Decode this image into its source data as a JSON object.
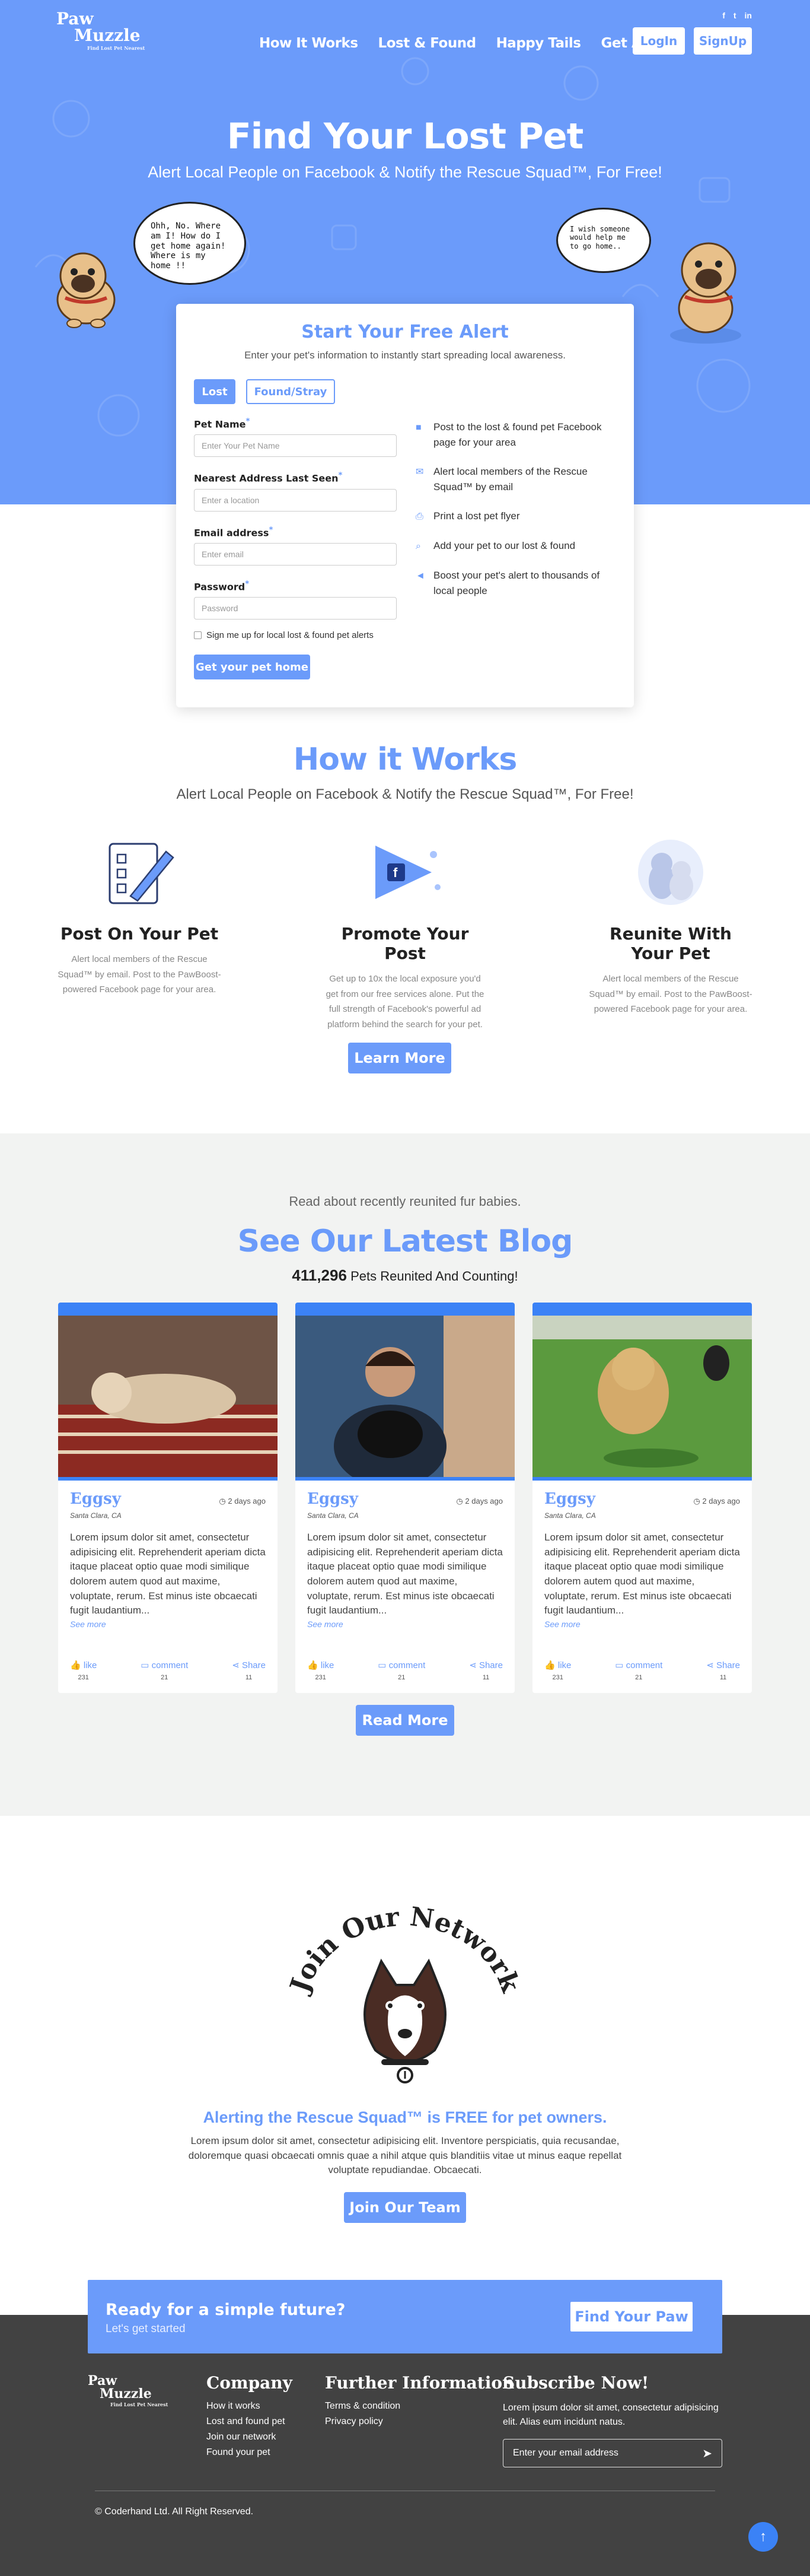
{
  "brand": {
    "line1": "Paw",
    "line2": "Muzzle",
    "tagline": "Find Lost Pet Nearest",
    "accent": "#6b9bfa"
  },
  "social": [
    "f",
    "t",
    "in"
  ],
  "nav": {
    "items": [
      "How It Works",
      "Lost & Found",
      "Happy Tails",
      "Get Alert"
    ],
    "login": "LogIn",
    "signup": "SignUp"
  },
  "hero": {
    "title": "Find Your Lost Pet",
    "subtitle": "Alert Local People on Facebook & Notify the Rescue Squad™, For Free!",
    "bubble1": "Ohh, No. Where am I! How do I get home again! Where is my home !!",
    "bubble2": "I wish someone would help me to go home.."
  },
  "form": {
    "title": "Start Your Free Alert",
    "subtitle": "Enter your pet's information to instantly start spreading local awareness.",
    "tab_lost": "Lost",
    "tab_found": "Found/Stray",
    "fields": [
      {
        "label": "Pet Name",
        "placeholder": "Enter Your Pet Name"
      },
      {
        "label": "Nearest Address Last Seen",
        "placeholder": "Enter a location"
      },
      {
        "label": "Email address",
        "placeholder": "Enter email"
      },
      {
        "label": "Password",
        "placeholder": "Password"
      }
    ],
    "required_mark": "*",
    "checkbox": "Sign me up for local lost & found pet alerts",
    "submit": "Get your pet home",
    "features": [
      {
        "icon": "facebook-icon",
        "text": "Post to the lost & found pet Facebook page for your area"
      },
      {
        "icon": "envelope-icon",
        "text": "Alert local members of the Rescue Squad™ by email"
      },
      {
        "icon": "printer-icon",
        "text": "Print a lost pet flyer"
      },
      {
        "icon": "search-icon",
        "text": "Add your pet to our lost & found"
      },
      {
        "icon": "megaphone-icon",
        "text": "Boost your pet's alert to thousands of local people"
      }
    ]
  },
  "how": {
    "title": "How it Works",
    "subtitle": "Alert Local People on Facebook & Notify the Rescue Squad™, For Free!",
    "steps": [
      {
        "title": "Post On Your Pet",
        "desc": "Alert local members of the Rescue Squad™ by email. Post to the PawBoost-powered Facebook page for your area."
      },
      {
        "title": "Promote Your Post",
        "desc": "Get up to 10x the local exposure you'd get from our free services alone. Put the full strength of Facebook's powerful ad platform behind the search for your pet."
      },
      {
        "title": "Reunite With Your Pet",
        "desc": "Alert local members of the Rescue Squad™ by email. Post to the PawBoost-powered Facebook page for your area."
      }
    ],
    "button": "Learn More"
  },
  "blog": {
    "kicker": "Read about recently reunited fur babies.",
    "title": "See Our Latest Blog",
    "count": "411,296",
    "count_label": "Pets Reunited And Counting!",
    "posts": [
      {
        "title": "Eggsy",
        "date": "2 days ago",
        "location": "Santa Clara, CA",
        "text": "Lorem ipsum dolor sit amet, consectetur adipisicing elit. Reprehenderit aperiam dicta itaque placeat optio quae modi similique dolorem autem quod aut maxime, voluptate, rerum. Est minus iste obcaecati fugit laudantium...",
        "more": "See more",
        "like": "like",
        "likes": "231",
        "comment": "comment",
        "comments": "21",
        "share": "Share",
        "shares": "11"
      },
      {
        "title": "Eggsy",
        "date": "2 days ago",
        "location": "Santa Clara, CA",
        "text": "Lorem ipsum dolor sit amet, consectetur adipisicing elit. Reprehenderit aperiam dicta itaque placeat optio quae modi similique dolorem autem quod aut maxime, voluptate, rerum. Est minus iste obcaecati fugit laudantium...",
        "more": "See more",
        "like": "like",
        "likes": "231",
        "comment": "comment",
        "comments": "21",
        "share": "Share",
        "shares": "11"
      },
      {
        "title": "Eggsy",
        "date": "2 days ago",
        "location": "Santa Clara, CA",
        "text": "Lorem ipsum dolor sit amet, consectetur adipisicing elit. Reprehenderit aperiam dicta itaque placeat optio quae modi similique dolorem autem quod aut maxime, voluptate, rerum. Est minus iste obcaecati fugit laudantium...",
        "more": "See more",
        "like": "like",
        "likes": "231",
        "comment": "comment",
        "comments": "21",
        "share": "Share",
        "shares": "11"
      }
    ],
    "button": "Read More"
  },
  "join": {
    "badge": "Join Our Network",
    "headline": "Alerting the Rescue Squad™ is FREE for pet owners.",
    "text": "Lorem ipsum dolor sit amet, consectetur adipisicing elit. Inventore perspiciatis, quia recusandae, doloremque quasi obcaecati omnis quae a nihil atque quis blanditiis vitae ut minus eaque repellat voluptate repudiandae. Obcaecati.",
    "button": "Join Our Team"
  },
  "ready": {
    "title": "Ready for a simple future?",
    "subtitle": "Let's get started",
    "button": "Find Your Paw"
  },
  "footer": {
    "company_title": "Company",
    "company_links": [
      "How it works",
      "Lost and found pet",
      "Join our network",
      "Found your pet"
    ],
    "info_title": "Further Information",
    "info_links": [
      "Terms & condition",
      "Privacy policy"
    ],
    "subscribe_title": "Subscribe Now!",
    "subscribe_text": "Lorem ipsum dolor sit amet, consectetur adipisicing elit. Alias eum incidunt natus.",
    "email_placeholder": "Enter your email address",
    "copyright": "© Coderhand Ltd. All Right Reserved."
  }
}
